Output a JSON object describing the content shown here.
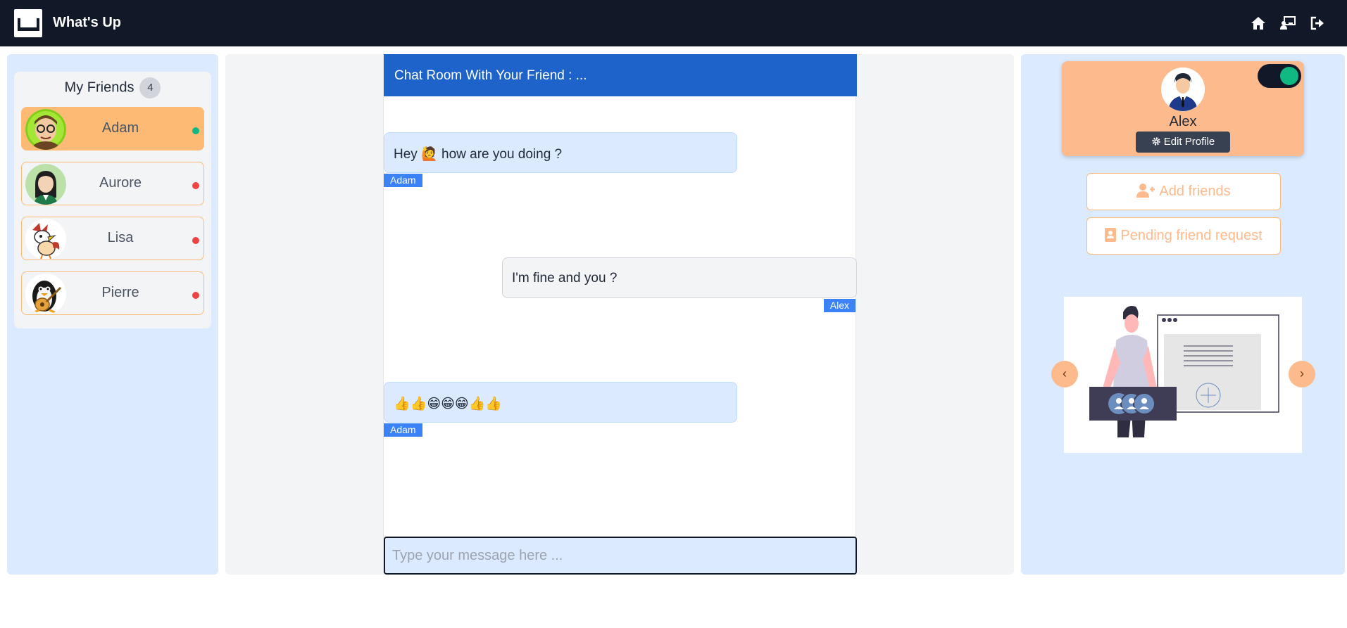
{
  "app": {
    "title": "What's Up"
  },
  "nav": {
    "icons": [
      "home-icon",
      "chalkboard-user-icon",
      "sign-out-icon"
    ]
  },
  "friends": {
    "title": "My Friends",
    "count": "4",
    "items": [
      {
        "name": "Adam",
        "status": "online",
        "active": true
      },
      {
        "name": "Aurore",
        "status": "offline",
        "active": false
      },
      {
        "name": "Lisa",
        "status": "offline",
        "active": false
      },
      {
        "name": "Pierre",
        "status": "offline",
        "active": false
      }
    ]
  },
  "chat": {
    "header": "Chat Room With Your Friend : ...",
    "messages": [
      {
        "text": "Hey 🙋 how are you doing ?",
        "author": "Adam",
        "mine": false
      },
      {
        "text": "I'm fine and you ?",
        "author": "Alex",
        "mine": true
      },
      {
        "text": "👍👍😁😁😁👍👍",
        "author": "Adam",
        "mine": false
      }
    ],
    "input_placeholder": "Type your message here ..."
  },
  "profile": {
    "name": "Alex",
    "edit_label": "Edit Profile",
    "toggle_on": true
  },
  "actions": {
    "add_friends": "Add friends",
    "pending": "Pending friend request"
  },
  "carousel": {
    "prev": "‹",
    "next": "›"
  },
  "colors": {
    "navbar": "#111827",
    "panel": "#dbeafe",
    "accent": "#fdba8c",
    "chat_header": "#1d63c9",
    "online": "#10b981",
    "offline": "#ef4444",
    "tag": "#3b82f6"
  }
}
